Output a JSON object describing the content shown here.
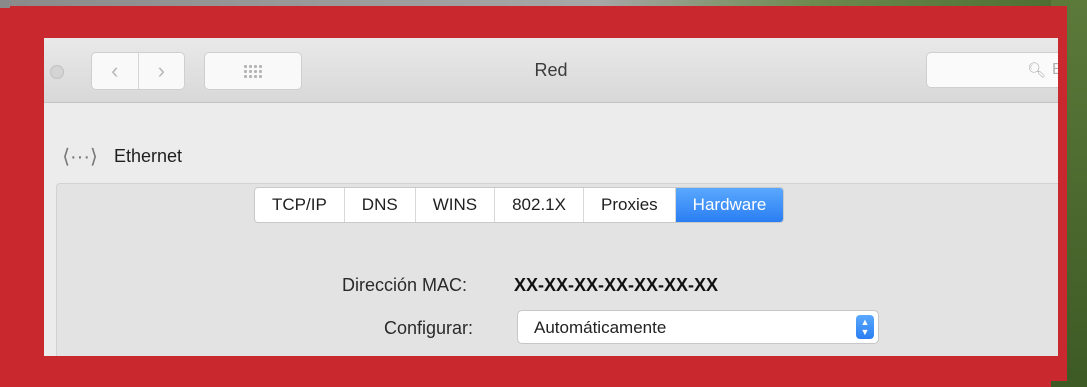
{
  "window": {
    "title": "Red",
    "search_placeholder": "Bu"
  },
  "nav": {
    "back_icon": "chevron-left-icon",
    "forward_icon": "chevron-right-icon",
    "grid_icon": "grid-icon"
  },
  "interface": {
    "icon": "ethernet-icon",
    "name": "Ethernet"
  },
  "tabs": [
    {
      "label": "TCP/IP"
    },
    {
      "label": "DNS"
    },
    {
      "label": "WINS"
    },
    {
      "label": "802.1X"
    },
    {
      "label": "Proxies"
    },
    {
      "label": "Hardware",
      "active": true
    }
  ],
  "hardware": {
    "mac_label": "Dirección MAC:",
    "mac_value": "XX-XX-XX-XX-XX-XX-XX",
    "configure_label": "Configurar:",
    "configure_value": "Automáticamente"
  },
  "colors": {
    "accent": "#2a7ef2",
    "frame": "#c9282f"
  }
}
